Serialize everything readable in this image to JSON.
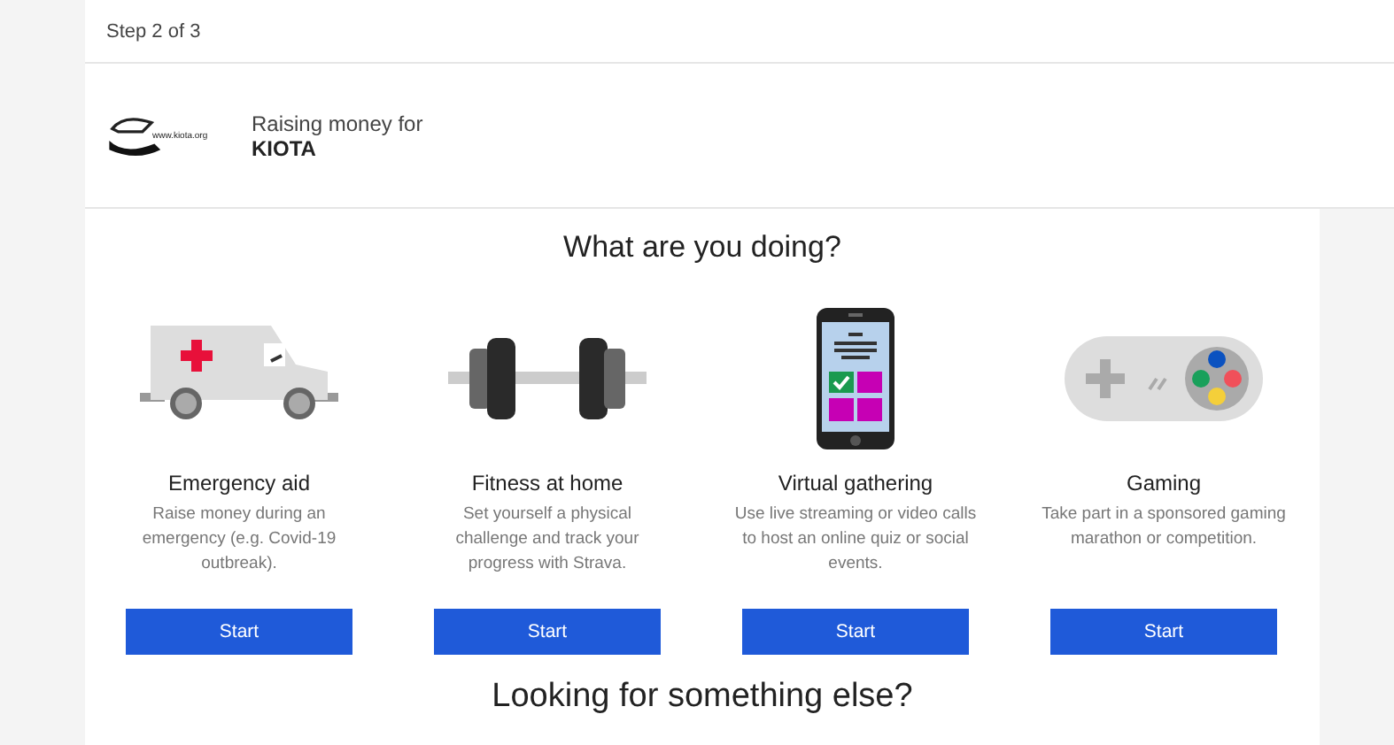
{
  "step": "Step 2 of 3",
  "charity": {
    "caption": "Raising money for",
    "name": "KIOTA",
    "logo_text": "www.kiota.org"
  },
  "heading": "What are you doing?",
  "activities": [
    {
      "kind": "ambulance",
      "title": "Emergency aid",
      "description": "Raise money during an emergency (e.g. Covid-19 outbreak).",
      "button": "Start"
    },
    {
      "kind": "dumbbell",
      "title": "Fitness at home",
      "description": "Set yourself a physical challenge and track your progress with Strava.",
      "button": "Start"
    },
    {
      "kind": "phone",
      "title": "Virtual gathering",
      "description": "Use live streaming or video calls to host an online quiz or social events.",
      "button": "Start"
    },
    {
      "kind": "gamepad",
      "title": "Gaming",
      "description": "Take part in a sponsored gaming marathon or competition.",
      "button": "Start"
    }
  ],
  "footer_heading": "Looking for something else?"
}
